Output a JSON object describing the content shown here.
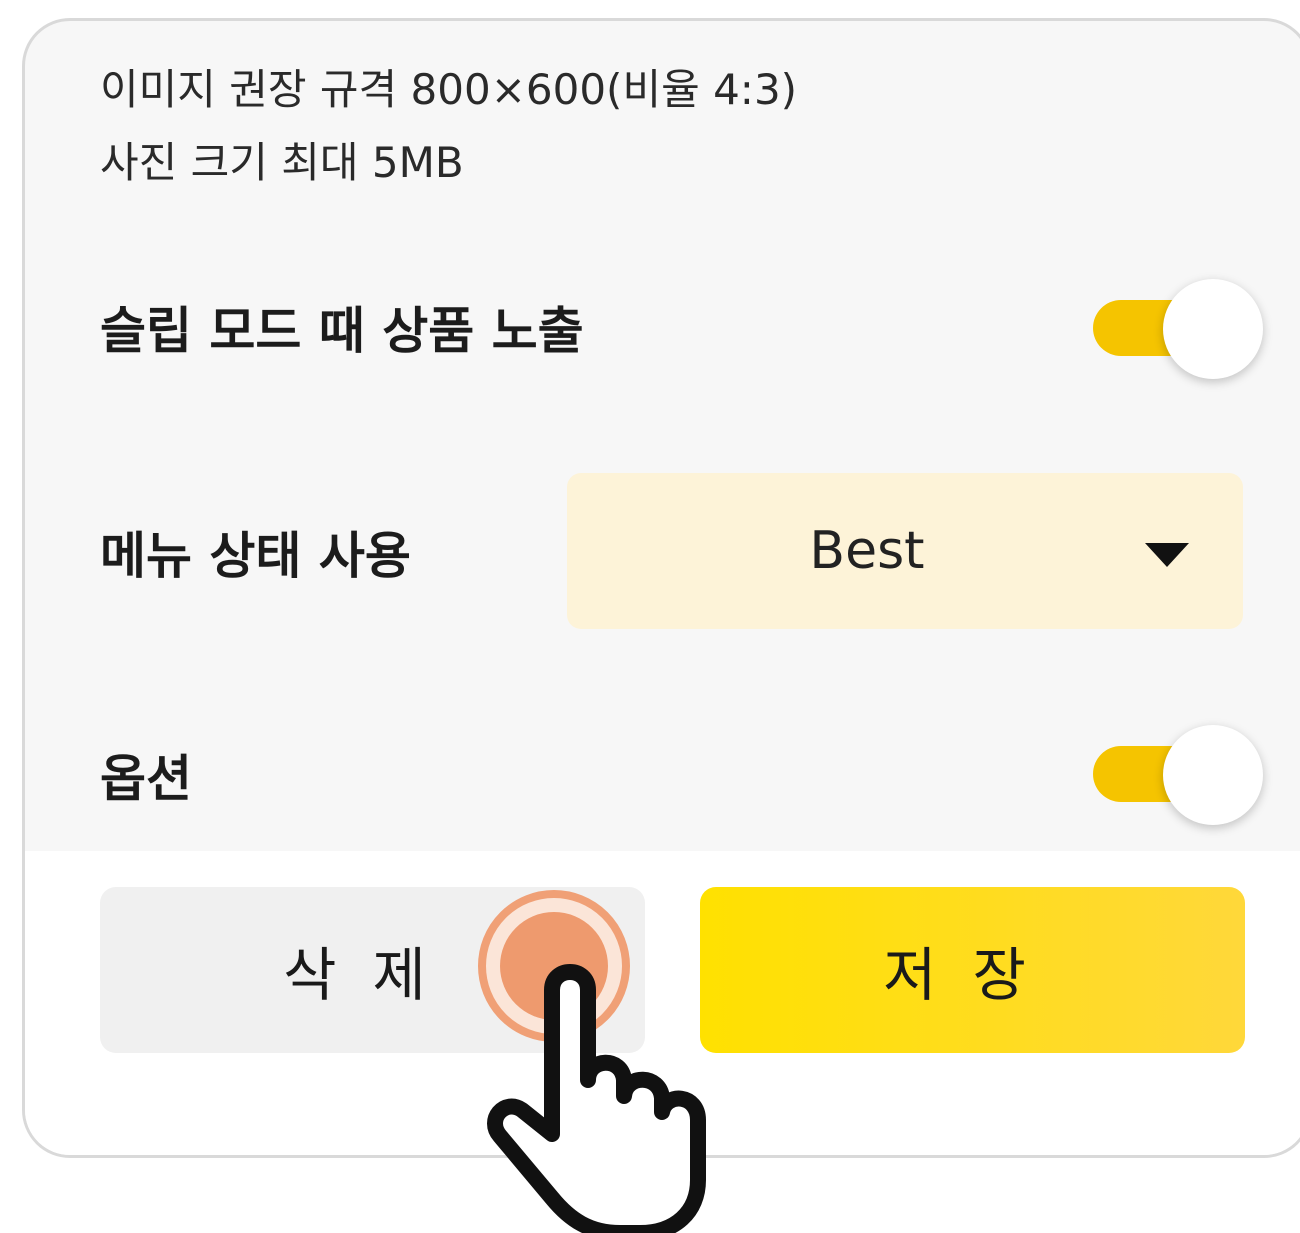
{
  "info": {
    "line1": "이미지 권장 규격 800×600(비율 4:3)",
    "line2": "사진 크기 최대 5MB"
  },
  "settings": {
    "slim_mode_label": "슬립 모드 때 상품 노출",
    "slim_mode_on": true,
    "menu_status_label": "메뉴 상태 사용",
    "menu_status_value": "Best",
    "option_label": "옵션",
    "option_on": true
  },
  "actions": {
    "delete_label": "삭제",
    "save_label": "저장"
  },
  "colors": {
    "accent": "#f5c400",
    "save_button": "#ffdc1f",
    "select_bg": "#fdf3d8",
    "tap_indicator": "#ee9a6e"
  },
  "icons": {
    "dropdown": "caret-down-icon",
    "pointer": "hand-pointer-icon",
    "tap": "tap-indicator-icon"
  }
}
